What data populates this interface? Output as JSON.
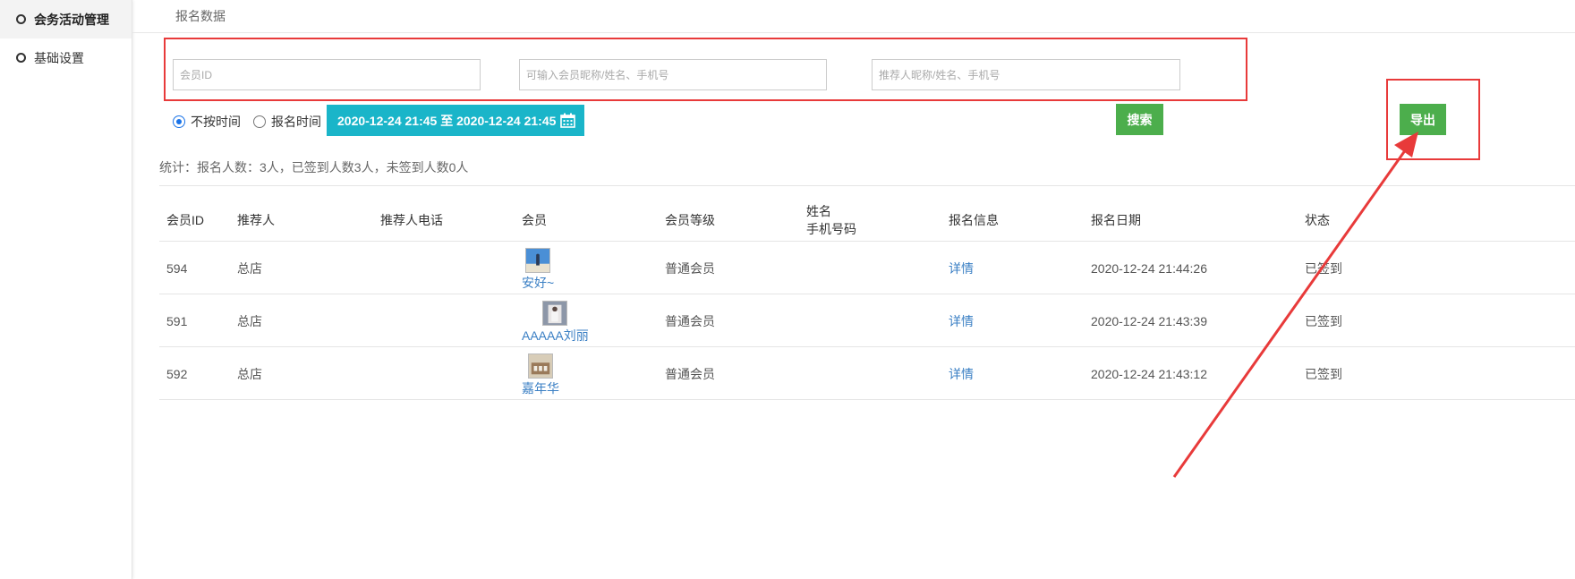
{
  "sidebar": {
    "items": [
      {
        "label": "会务活动管理",
        "active": true
      },
      {
        "label": "基础设置",
        "active": false
      }
    ]
  },
  "page": {
    "title": "报名数据"
  },
  "filters": {
    "member_id_placeholder": "会员ID",
    "member_info_placeholder": "可输入会员昵称/姓名、手机号",
    "referrer_placeholder": "推荐人昵称/姓名、手机号",
    "time_options": [
      {
        "label": "不按时间",
        "checked": true
      },
      {
        "label": "报名时间",
        "checked": false
      }
    ],
    "date_range": "2020-12-24 21:45 至 2020-12-24 21:45",
    "search_label": "搜索",
    "export_label": "导出"
  },
  "stats": {
    "text": "统计：报名人数：3人，已签到人数3人，未签到人数0人"
  },
  "table": {
    "headers": {
      "member_id": "会员ID",
      "referrer": "推荐人",
      "referrer_phone": "推荐人电话",
      "member": "会员",
      "member_level": "会员等级",
      "name": "姓名",
      "phone": "手机号码",
      "signup_info": "报名信息",
      "signup_date": "报名日期",
      "status": "状态"
    },
    "rows": [
      {
        "member_id": "594",
        "referrer": "总店",
        "referrer_phone": "",
        "member_name": "安好~",
        "avatar": "blue-sky-photo",
        "level": "普通会员",
        "name": "",
        "phone": "",
        "info": "详情",
        "date": "2020-12-24 21:44:26",
        "status": "已签到"
      },
      {
        "member_id": "591",
        "referrer": "总店",
        "referrer_phone": "",
        "member_name": "AAAAA刘丽",
        "avatar": "portrait-photo",
        "level": "普通会员",
        "name": "",
        "phone": "",
        "info": "详情",
        "date": "2020-12-24 21:43:39",
        "status": "已签到"
      },
      {
        "member_id": "592",
        "referrer": "总店",
        "referrer_phone": "",
        "member_name": "嘉年华",
        "avatar": "building-photo",
        "level": "普通会员",
        "name": "",
        "phone": "",
        "info": "详情",
        "date": "2020-12-24 21:43:12",
        "status": "已签到"
      }
    ]
  },
  "colors": {
    "annotation_red": "#e83a3a",
    "accent_cyan": "#1ab5c9",
    "button_green": "#4cae4c",
    "link_blue": "#3a7fc4"
  },
  "icons": {
    "calendar": "calendar-icon",
    "radio": "radio-icon"
  }
}
